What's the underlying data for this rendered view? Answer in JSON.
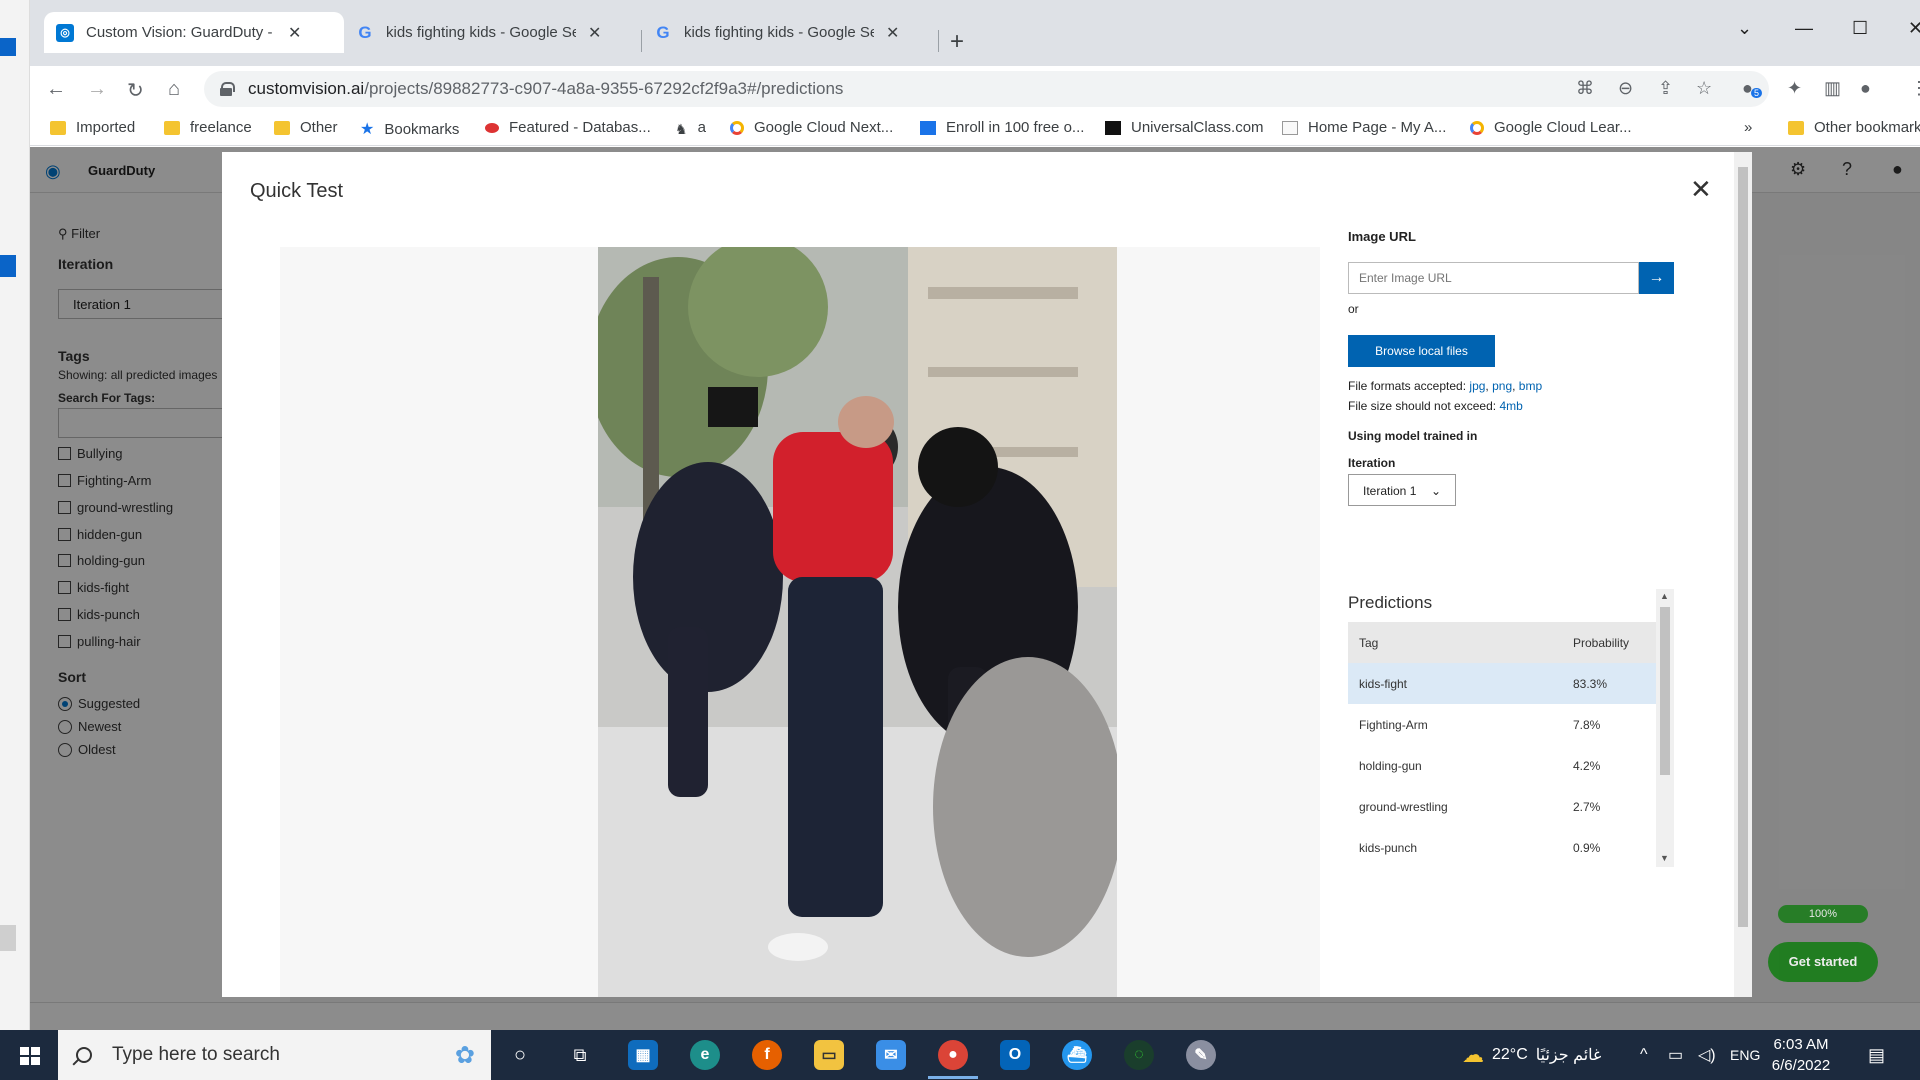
{
  "browser": {
    "tabs": [
      {
        "title": "Custom Vision: GuardDuty - Pred",
        "favicon": "custom-vision"
      },
      {
        "title": "kids fighting kids - Google Searc",
        "favicon": "google"
      },
      {
        "title": "kids fighting kids - Google Searc",
        "favicon": "google"
      }
    ],
    "url_domain": "customvision.ai",
    "url_path": "/projects/89882773-c907-4a8a-9355-67292cf2f9a3#/predictions",
    "extension_badge": "5",
    "bookmarks": [
      {
        "label": "Imported",
        "icon": "folder"
      },
      {
        "label": "freelance",
        "icon": "folder"
      },
      {
        "label": "Other",
        "icon": "folder"
      },
      {
        "label": "Bookmarks",
        "icon": "star"
      },
      {
        "label": "Featured - Databas...",
        "icon": "featured"
      },
      {
        "label": "a",
        "icon": "figure"
      },
      {
        "label": "Google Cloud Next...",
        "icon": "gcloud"
      },
      {
        "label": "Enroll in 100 free o...",
        "icon": "blue-square"
      },
      {
        "label": "UniversalClass.com",
        "icon": "black-square"
      },
      {
        "label": "Home Page - My A...",
        "icon": "doc"
      },
      {
        "label": "Google Cloud Lear...",
        "icon": "gcloud"
      }
    ],
    "other_bookmarks": "Other bookmarks"
  },
  "app": {
    "project_name": "GuardDuty",
    "filter_label": "Filter",
    "iteration_label": "Iteration",
    "iteration_value": "Iteration 1",
    "tags_label": "Tags",
    "tags_showing": "Showing: all predicted images",
    "search_tags_label": "Search For Tags:",
    "tags": [
      "Bullying",
      "Fighting-Arm",
      "ground-wrestling",
      "hidden-gun",
      "holding-gun",
      "kids-fight",
      "kids-punch",
      "pulling-hair"
    ],
    "sort_label": "Sort",
    "sort_options": [
      {
        "label": "Suggested",
        "selected": true
      },
      {
        "label": "Newest",
        "selected": false
      },
      {
        "label": "Oldest",
        "selected": false
      }
    ],
    "progress_label": "100%",
    "get_started": "Get started"
  },
  "modal": {
    "title": "Quick Test",
    "image_url_label": "Image URL",
    "image_url_placeholder": "Enter Image URL",
    "or_text": "or",
    "browse_button": "Browse local files",
    "formats_prefix": "File formats accepted:",
    "formats": [
      "jpg",
      "png",
      "bmp"
    ],
    "size_prefix": "File size should not exceed:",
    "size_limit": "4mb",
    "model_label": "Using model trained in",
    "iteration_label": "Iteration",
    "iteration_value": "Iteration 1",
    "predictions_title": "Predictions",
    "columns": [
      "Tag",
      "Probability"
    ],
    "predictions": [
      {
        "tag": "kids-fight",
        "probability": "83.3%"
      },
      {
        "tag": "Fighting-Arm",
        "probability": "7.8%"
      },
      {
        "tag": "holding-gun",
        "probability": "4.2%"
      },
      {
        "tag": "ground-wrestling",
        "probability": "2.7%"
      },
      {
        "tag": "kids-punch",
        "probability": "0.9%"
      }
    ]
  },
  "taskbar": {
    "search_placeholder": "Type here to search",
    "weather": "22°C",
    "weather_text": "غائم جزئيًا",
    "language": "ENG",
    "time": "6:03 AM",
    "date": "6/6/2022"
  },
  "colors": {
    "accent": "#0063b1",
    "selected_row": "#dbe9f6",
    "taskbar": "#1c2a3e",
    "success": "#107c10"
  }
}
